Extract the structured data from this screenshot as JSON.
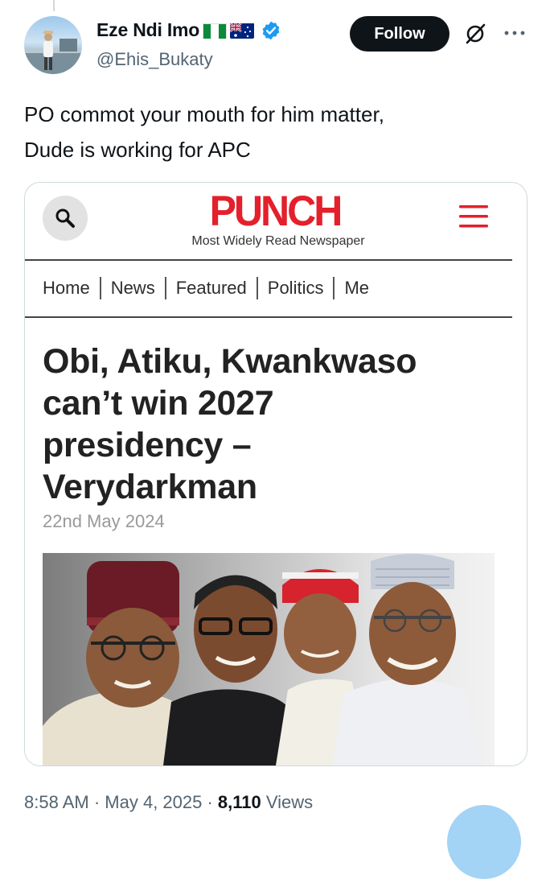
{
  "tweet": {
    "author": {
      "display_name": "Eze Ndi Imo",
      "flags": [
        "nigeria-flag",
        "australia-flag"
      ],
      "verified": true,
      "verified_color": "#1d9bf0",
      "handle": "@Ehis_Bukaty"
    },
    "follow_label": "Follow",
    "text_lines": [
      "PO commot your mouth for him matter,",
      "Dude is working for APC"
    ],
    "meta": {
      "time": "8:58 AM",
      "separator": " · ",
      "date": "May 4, 2025",
      "views_count": "8,110",
      "views_label": " Views"
    }
  },
  "article_card": {
    "brand": "PUNCH",
    "brand_color": "#e3202b",
    "tagline": "Most Widely Read Newspaper",
    "nav_items": [
      "Home",
      "News",
      "Featured",
      "Politics",
      "Me"
    ],
    "headline_lines": [
      "Obi, Atiku, Kwankwaso",
      "can’t win 2027",
      "presidency –",
      "Verydarkman"
    ],
    "date": "22nd May 2024"
  },
  "icons": {
    "search": "search-icon",
    "menu": "hamburger-menu-icon",
    "grok": "grok-icon",
    "more": "more-icon"
  }
}
